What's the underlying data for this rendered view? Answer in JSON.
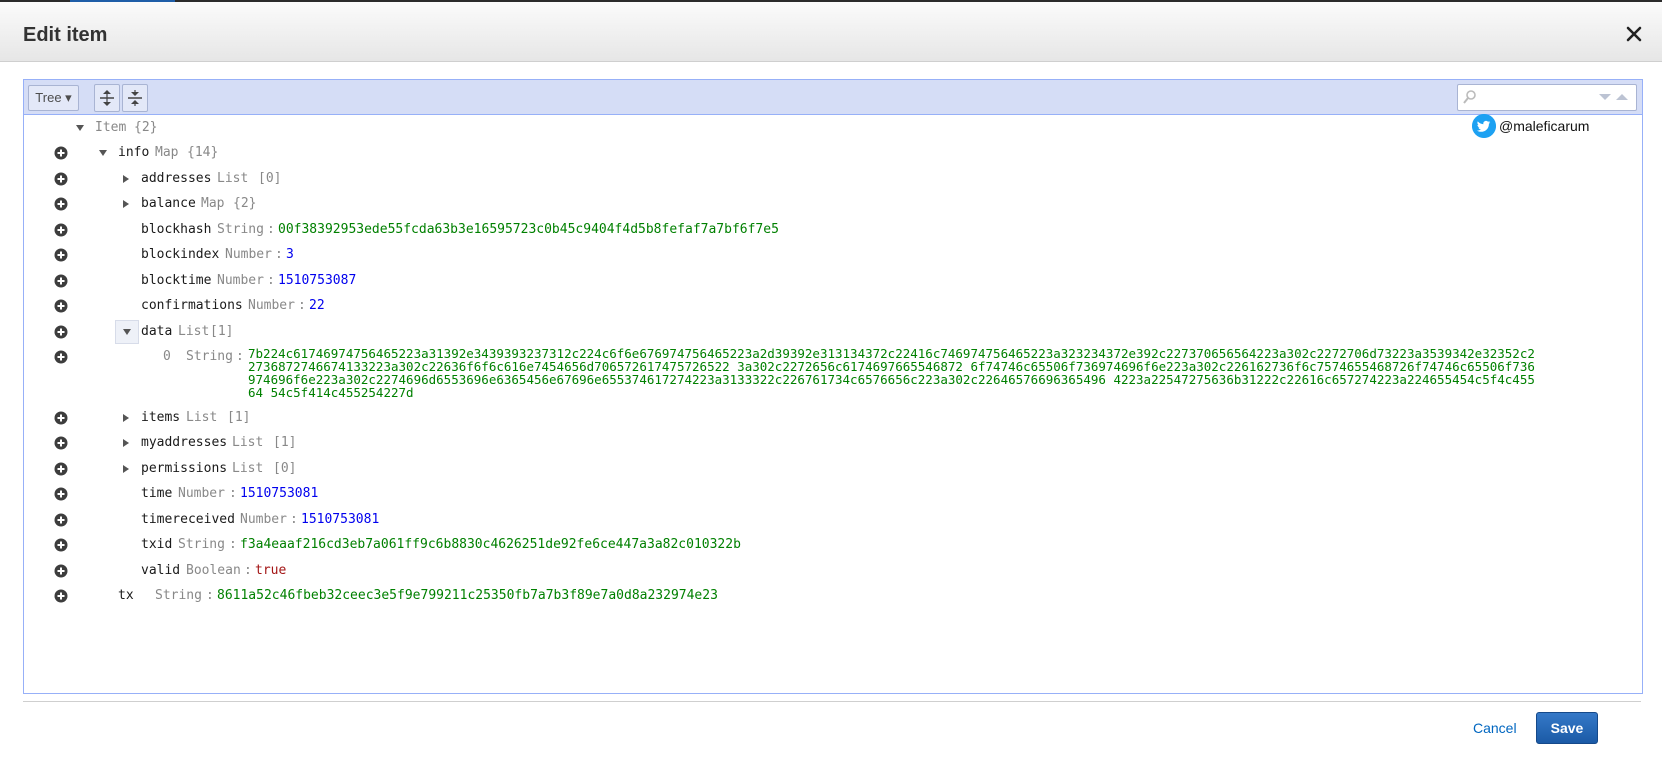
{
  "header": {
    "title": "Edit item",
    "close_icon": "close-icon"
  },
  "toolbar": {
    "mode_label": "Tree ▾",
    "expand_icon": "expand-all-icon",
    "collapse_icon": "collapse-all-icon",
    "search_placeholder": ""
  },
  "twitter": {
    "handle": "@maleficarum",
    "icon": "twitter-bird-icon",
    "color": "#1da1f2"
  },
  "tree": {
    "root": {
      "field": "Item",
      "summary": "{2}"
    },
    "info": {
      "field": "info",
      "type": "Map",
      "summary": "{14}"
    },
    "addresses": {
      "field": "addresses",
      "type": "List",
      "summary": "[0]"
    },
    "balance": {
      "field": "balance",
      "type": "Map",
      "summary": "{2}"
    },
    "blockhash": {
      "field": "blockhash",
      "type": "String",
      "value": "00f38392953ede55fcda63b3e16595723c0b45c9404f4d5b8fefaf7a7bf6f7e5"
    },
    "blockindex": {
      "field": "blockindex",
      "type": "Number",
      "value": "3"
    },
    "blocktime": {
      "field": "blocktime",
      "type": "Number",
      "value": "1510753087"
    },
    "confirmations": {
      "field": "confirmations",
      "type": "Number",
      "value": "22"
    },
    "data": {
      "field": "data",
      "type": "List",
      "summary": "[1]"
    },
    "data0": {
      "field": "0",
      "type": "String",
      "value": "7b224c61746974756465223a31392e3439393237312c224c6f6e676974756465223a2d39392e313134372c22416c746974756465223a323234372e392c227370656564223a302c2272706d73223a3539342e32352c22736872746674133223a302c22636f6f6c616e7454656d706572617475726522 3a302c2272656c6174697665546872 6f74746c65506f736974696f6e223a302c226162736f6c7574655468726f74746c65506f736974696f6e223a302c2274696d6553696e6365456e67696e655374617274223a3133322c226761734c6576656c223a302c22646576696365496 4223a22547275636b31222c22616c657274223a224655454c5f4c45564 54c5f414c455254227d"
    },
    "items": {
      "field": "items",
      "type": "List",
      "summary": "[1]"
    },
    "myaddresses": {
      "field": "myaddresses",
      "type": "List",
      "summary": "[1]"
    },
    "permissions": {
      "field": "permissions",
      "type": "List",
      "summary": "[0]"
    },
    "time": {
      "field": "time",
      "type": "Number",
      "value": "1510753081"
    },
    "timereceived": {
      "field": "timereceived",
      "type": "Number",
      "value": "1510753081"
    },
    "txid": {
      "field": "txid",
      "type": "String",
      "value": "f3a4eaaf216cd3eb7a061ff9c6b8830c4626251de92fe6ce447a3a82c010322b"
    },
    "valid": {
      "field": "valid",
      "type": "Boolean",
      "value": "true"
    },
    "tx": {
      "field": "tx",
      "type": "String",
      "value": "8611a52c46fbeb32ceec3e5f9e799211c25350fb7a7b3f89e7a0d8a232974e23"
    }
  },
  "footer": {
    "cancel_label": "Cancel",
    "save_label": "Save"
  },
  "colors": {
    "string": "#008000",
    "number": "#0000ee",
    "boolean": "#a31515",
    "accent": "#1b5aa6",
    "menu": "#d5ddf6"
  }
}
